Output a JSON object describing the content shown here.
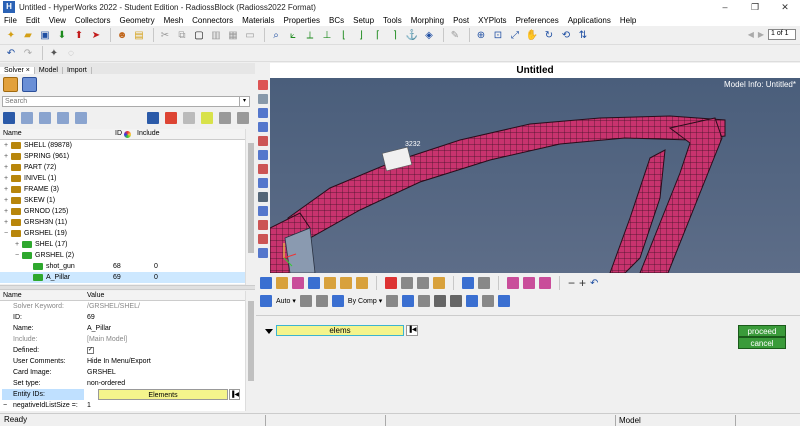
{
  "window": {
    "title": "Untitled - HyperWorks 2022 - Student Edition - RadiossBlock (Radioss2022 Format)",
    "controls": [
      "–",
      "❐",
      "✕"
    ]
  },
  "menu": [
    "File",
    "Edit",
    "View",
    "Collectors",
    "Geometry",
    "Mesh",
    "Connectors",
    "Materials",
    "Properties",
    "BCs",
    "Setup",
    "Tools",
    "Morphing",
    "Post",
    "XYPlots",
    "Preferences",
    "Applications",
    "Help"
  ],
  "pager": {
    "value": "1",
    "of_label": "of 1"
  },
  "left_panel": {
    "tabs": [
      "Solver ×",
      "Model",
      "Import"
    ],
    "search_placeholder": "Search",
    "tree_header": {
      "name": "Name",
      "id": "ID",
      "include": "Include"
    },
    "tree": [
      {
        "label": "SHELL  (89878)",
        "indent": 1,
        "color": "#b8860b",
        "expand": "+"
      },
      {
        "label": "SPRING  (961)",
        "indent": 1,
        "color": "#b8860b",
        "expand": "+"
      },
      {
        "label": "PART  (72)",
        "indent": 1,
        "color": "#b8860b",
        "expand": "+"
      },
      {
        "label": "INIVEL  (1)",
        "indent": 1,
        "color": "#b8860b",
        "expand": "+"
      },
      {
        "label": "FRAME  (3)",
        "indent": 1,
        "color": "#b8860b",
        "expand": "+"
      },
      {
        "label": "SKEW  (1)",
        "indent": 1,
        "color": "#b8860b",
        "expand": "+"
      },
      {
        "label": "GRNOD  (125)",
        "indent": 1,
        "color": "#b8860b",
        "expand": "+"
      },
      {
        "label": "GRSH3N  (11)",
        "indent": 1,
        "color": "#b8860b",
        "expand": "+"
      },
      {
        "label": "GRSHEL  (19)",
        "indent": 1,
        "color": "#b8860b",
        "expand": "−"
      },
      {
        "label": "SHEL  (17)",
        "indent": 2,
        "color": "#2ea82e",
        "expand": "+"
      },
      {
        "label": "GRSHEL  (2)",
        "indent": 2,
        "color": "#2ea82e",
        "expand": "−"
      },
      {
        "label": "shot_gun",
        "indent": 3,
        "color": "#2ea82e",
        "expand": "",
        "id": "68",
        "inc": "0"
      },
      {
        "label": "A_Pillar",
        "indent": 3,
        "color": "#2ea82e",
        "expand": "",
        "id": "69",
        "inc": "0",
        "selected": true
      }
    ],
    "prop_header": {
      "name": "Name",
      "value": "Value"
    },
    "props": [
      {
        "k": "Solver Keyword:",
        "v": "/GRSHEL/SHEL/",
        "dim": true
      },
      {
        "k": "ID:",
        "v": "69"
      },
      {
        "k": "Name:",
        "v": "A_Pillar"
      },
      {
        "k": "Include:",
        "v": "[Main Model]",
        "dim": true
      },
      {
        "k": "Defined:",
        "v": "✓",
        "check": true
      },
      {
        "k": "User Comments:",
        "v": "Hide In Menu/Export"
      },
      {
        "k": "Card Image:",
        "v": "GRSHEL"
      },
      {
        "k": "Set type:",
        "v": "non-ordered"
      },
      {
        "k": "Entity IDs:",
        "v": "Elements",
        "entity": true
      },
      {
        "k": "negativeIdListSize =:",
        "v": "1",
        "expand": "−"
      }
    ]
  },
  "graphics": {
    "title": "Untitled",
    "model_info": "Model Info: Untitled*",
    "node_label": "3232"
  },
  "bottom_toolbar": {
    "auto_label": "Auto",
    "bycomp_label": "By Comp"
  },
  "panel": {
    "selector_label": "elems",
    "proceed": "proceed",
    "cancel": "cancel"
  },
  "status": {
    "left": "Ready",
    "model": "Model"
  }
}
